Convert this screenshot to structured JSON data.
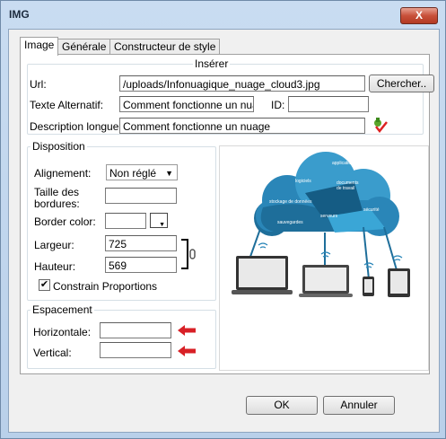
{
  "window": {
    "title": "IMG",
    "close_label": "X"
  },
  "tabs": [
    "Image",
    "Générale",
    "Constructeur de style"
  ],
  "inserer": {
    "legend": "Insérer",
    "url_label": "Url:",
    "url_value": "/uploads/Infonuagique_nuage_cloud3.jpg",
    "browse_button": "Chercher..",
    "alt_label": "Texte Alternatif:",
    "alt_value": "Comment fonctionne un nuage",
    "id_label": "ID:",
    "id_value": "",
    "longdesc_label": "Description longue:",
    "longdesc_value": "Comment fonctionne un nuage"
  },
  "disposition": {
    "legend": "Disposition",
    "align_label": "Alignement:",
    "align_value": "Non réglé",
    "border_size_label_1": "Taille des",
    "border_size_label_2": "bordures:",
    "border_size_value": "",
    "border_color_label": "Border color:",
    "border_color_value": "",
    "width_label": "Largeur:",
    "width_value": "725",
    "height_label": "Hauteur:",
    "height_value": "569",
    "constrain_label": "Constrain Proportions",
    "constrain_checked": true
  },
  "espacement": {
    "legend": "Espacement",
    "horizontal_label": "Horizontale:",
    "horizontal_value": "",
    "vertical_label": "Vertical:",
    "vertical_value": ""
  },
  "preview": {
    "cloud_labels": [
      "applications",
      "logiciels",
      "documents",
      "de travail",
      "stockage de données",
      "serveurs",
      "sécurité",
      "sauvegardes"
    ],
    "colors": {
      "cloud_dark": "#1e6e9a",
      "cloud_mid": "#2a86b8",
      "cloud_light": "#3a9ccc",
      "accent": "#d82026"
    }
  },
  "footer": {
    "ok_label": "OK",
    "cancel_label": "Annuler"
  }
}
